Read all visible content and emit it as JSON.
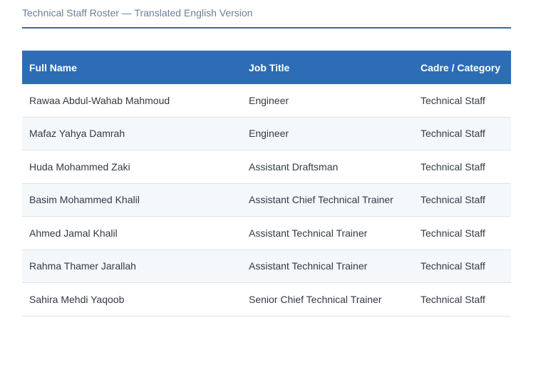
{
  "document": {
    "title": "Technical Staff Roster — Translated English Version"
  },
  "table": {
    "headers": [
      "Full Name",
      "Job Title",
      "Cadre / Category"
    ],
    "rows": [
      [
        "Rawaa Abdul-Wahab Mahmoud",
        "Engineer",
        "Technical Staff"
      ],
      [
        "Mafaz Yahya Damrah",
        "Engineer",
        "Technical Staff"
      ],
      [
        "Huda Mohammed Zaki",
        "Assistant Draftsman",
        "Technical Staff"
      ],
      [
        "Basim Mohammed Khalil",
        "Assistant Chief Technical Trainer",
        "Technical Staff"
      ],
      [
        "Ahmed Jamal Khalil",
        "Assistant Technical Trainer",
        "Technical Staff"
      ],
      [
        "Rahma Thamer Jarallah",
        "Assistant Technical Trainer",
        "Technical Staff"
      ],
      [
        "Sahira Mehdi Yaqoob",
        "Senior Chief Technical Trainer",
        "Technical Staff"
      ]
    ]
  },
  "colors": {
    "accent": "#2d6db5",
    "header_text": "#ffffff",
    "title_text": "#6a7f96",
    "body_text": "#333a44",
    "stripe": "#f5f8fb",
    "row_border": "#dde3ea"
  }
}
